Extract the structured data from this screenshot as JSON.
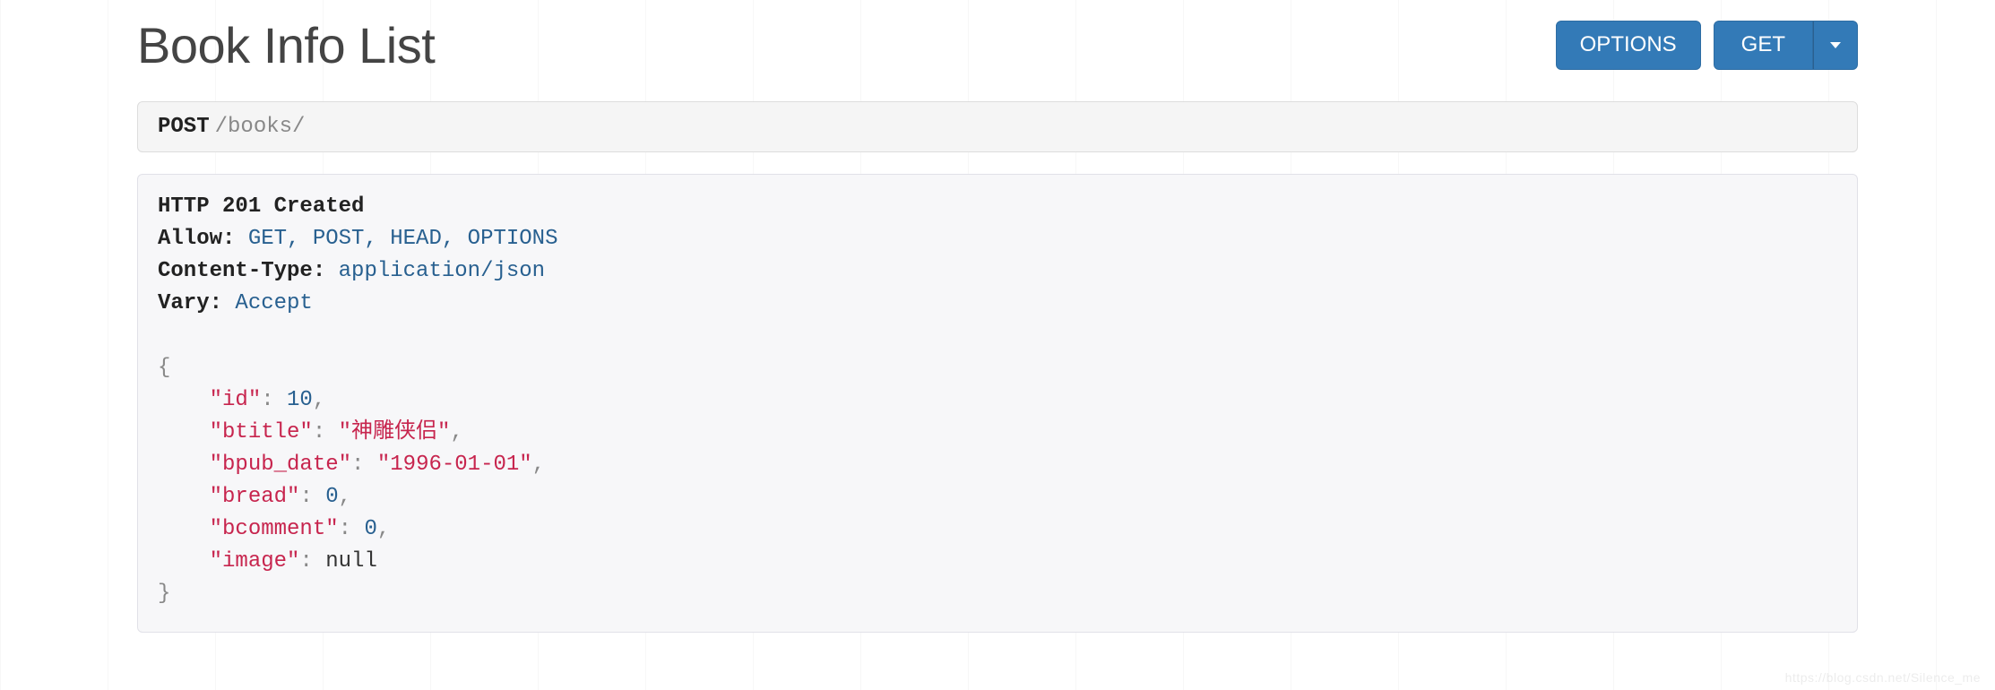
{
  "page": {
    "title": "Book Info List"
  },
  "actions": {
    "options_label": "OPTIONS",
    "get_label": "GET"
  },
  "request": {
    "method": "POST",
    "path": "/books/"
  },
  "response": {
    "status_line": "HTTP 201 Created",
    "headers": {
      "allow_name": "Allow:",
      "allow_value": "GET, POST, HEAD, OPTIONS",
      "content_type_name": "Content-Type:",
      "content_type_value": "application/json",
      "vary_name": "Vary:",
      "vary_value": "Accept"
    },
    "body": {
      "keys": {
        "id": "\"id\"",
        "btitle": "\"btitle\"",
        "bpub_date": "\"bpub_date\"",
        "bread": "\"bread\"",
        "bcomment": "\"bcomment\"",
        "image": "\"image\""
      },
      "values": {
        "id": "10",
        "btitle": "\"神雕侠侣\"",
        "bpub_date": "\"1996-01-01\"",
        "bread": "0",
        "bcomment": "0",
        "image": "null"
      }
    }
  },
  "watermark": "https://blog.csdn.net/Silence_me"
}
